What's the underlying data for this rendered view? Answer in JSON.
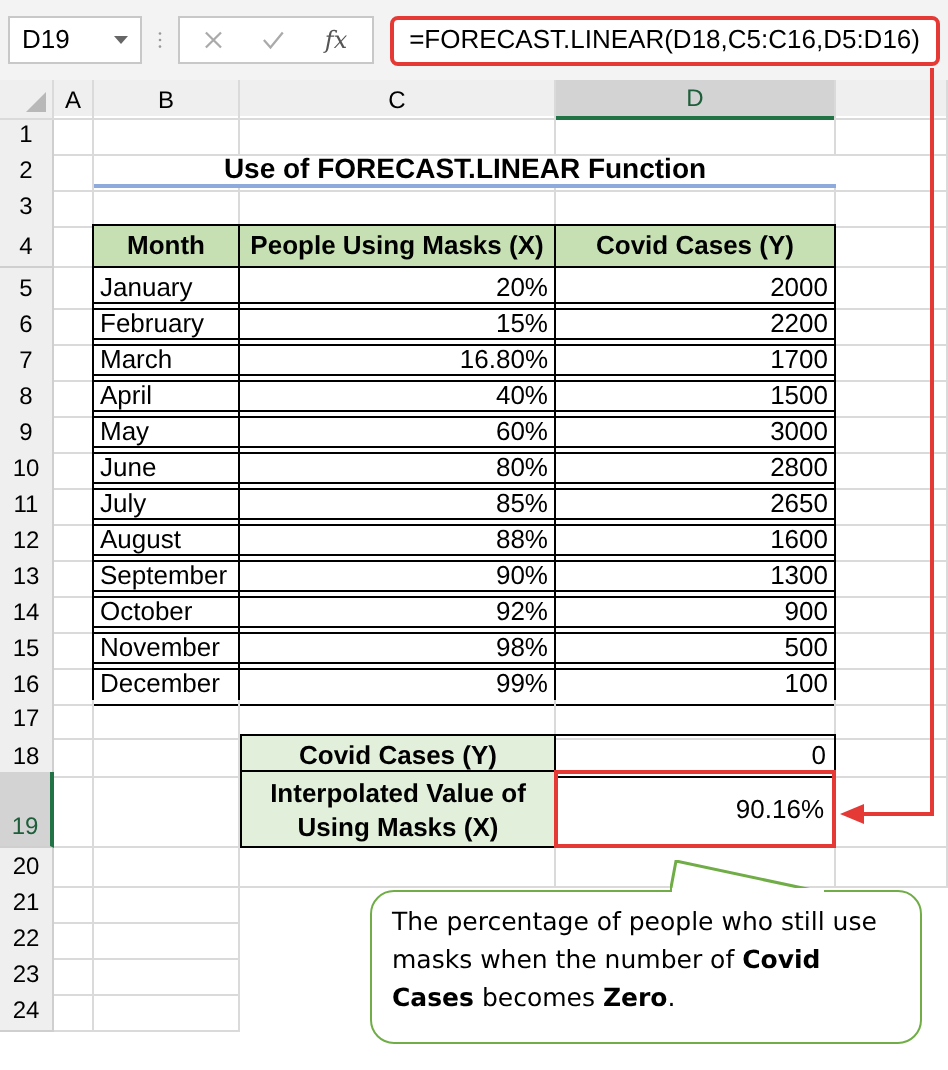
{
  "formula_bar": {
    "name_box": "D19",
    "fx": "fx",
    "formula": "=FORECAST.LINEAR(D18,C5:C16,D5:D16)"
  },
  "column_headers": [
    {
      "label": "A",
      "selected": false
    },
    {
      "label": "B",
      "selected": false
    },
    {
      "label": "C",
      "selected": false
    },
    {
      "label": "D",
      "selected": true
    }
  ],
  "row_numbers": [
    {
      "label": "1",
      "selected": false
    },
    {
      "label": "2",
      "selected": false
    },
    {
      "label": "3",
      "selected": false
    },
    {
      "label": "4",
      "selected": false
    },
    {
      "label": "5",
      "selected": false
    },
    {
      "label": "6",
      "selected": false
    },
    {
      "label": "7",
      "selected": false
    },
    {
      "label": "8",
      "selected": false
    },
    {
      "label": "9",
      "selected": false
    },
    {
      "label": "10",
      "selected": false
    },
    {
      "label": "11",
      "selected": false
    },
    {
      "label": "12",
      "selected": false
    },
    {
      "label": "13",
      "selected": false
    },
    {
      "label": "14",
      "selected": false
    },
    {
      "label": "15",
      "selected": false
    },
    {
      "label": "16",
      "selected": false
    },
    {
      "label": "17",
      "selected": false
    },
    {
      "label": "18",
      "selected": false
    },
    {
      "label": "19",
      "selected": true
    },
    {
      "label": "20",
      "selected": false
    },
    {
      "label": "21",
      "selected": false
    },
    {
      "label": "22",
      "selected": false
    },
    {
      "label": "23",
      "selected": false
    },
    {
      "label": "24",
      "selected": false
    }
  ],
  "title": "Use of FORECAST.LINEAR Function",
  "table": {
    "columns": [
      "Month",
      "People Using Masks (X)",
      "Covid Cases (Y)"
    ],
    "rows": [
      [
        "January",
        "20%",
        "2000"
      ],
      [
        "February",
        "15%",
        "2200"
      ],
      [
        "March",
        "16.80%",
        "1700"
      ],
      [
        "April",
        "40%",
        "1500"
      ],
      [
        "May",
        "60%",
        "3000"
      ],
      [
        "June",
        "80%",
        "2800"
      ],
      [
        "July",
        "85%",
        "2650"
      ],
      [
        "August",
        "88%",
        "1600"
      ],
      [
        "September",
        "90%",
        "1300"
      ],
      [
        "October",
        "92%",
        "900"
      ],
      [
        "November",
        "98%",
        "500"
      ],
      [
        "December",
        "99%",
        "100"
      ]
    ]
  },
  "summary": [
    {
      "label": "Covid Cases (Y)",
      "value": "0",
      "highlighted": false
    },
    {
      "label": "Interpolated Value of Using Masks (X)",
      "value": "90.16%",
      "highlighted": true
    }
  ],
  "callout": "The percentage of people who still use masks when the number of **Covid Cases** becomes **Zero**."
}
